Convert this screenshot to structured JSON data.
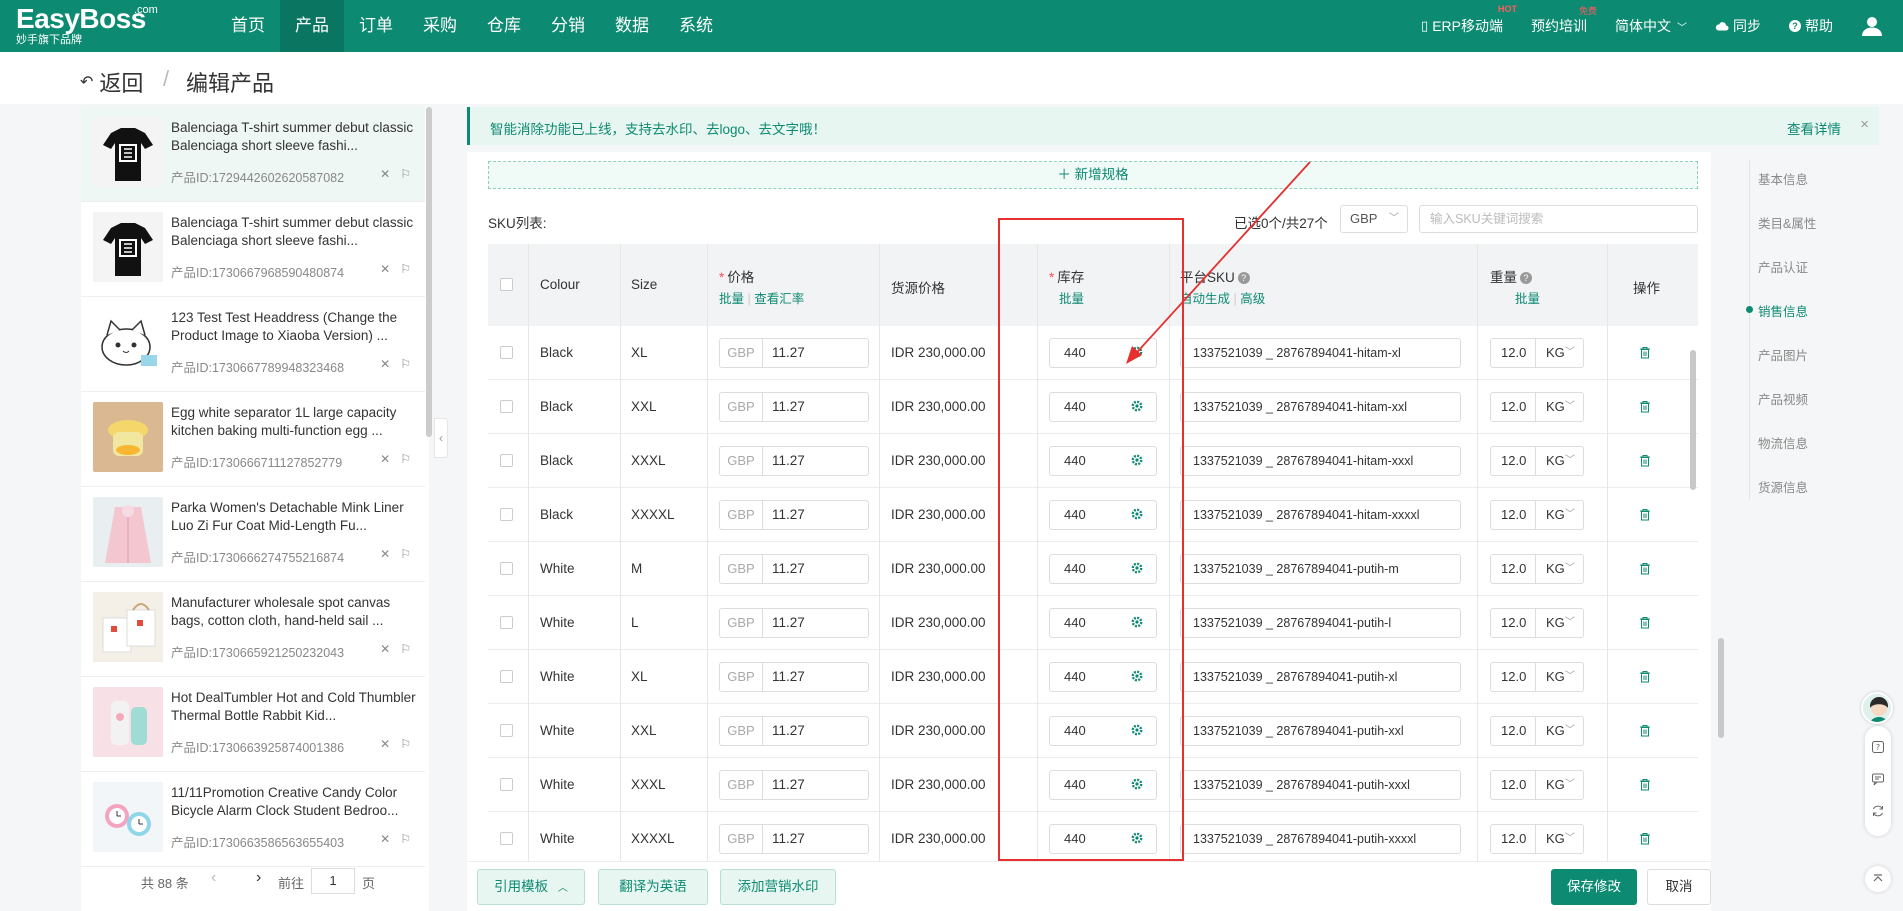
{
  "brand": {
    "name": "EasyBoss",
    "com": ".com",
    "tagline": "妙手旗下品牌"
  },
  "nav": [
    "首页",
    "产品",
    "订单",
    "采购",
    "仓库",
    "分销",
    "数据",
    "系统"
  ],
  "nav_active": "产品",
  "topright": {
    "mobile": "ERP移动端",
    "mobile_badge": "HOT",
    "training": "预约培训",
    "training_badge": "免费",
    "language": "简体中文",
    "sync": "同步",
    "help": "帮助"
  },
  "header": {
    "back": "返回",
    "separator": "/",
    "title": "编辑产品"
  },
  "products": [
    {
      "name": "Balenciaga T-shirt summer debut classic Balenciaga short sleeve fashi...",
      "id": "产品ID:1729442602620587082",
      "img": "tshirt"
    },
    {
      "name": "Balenciaga T-shirt summer debut classic Balenciaga short sleeve fashi...",
      "id": "产品ID:1730667968590480874",
      "img": "tshirt"
    },
    {
      "name": "123 Test Test Headdress (Change the Product Image to Xiaoba Version) ...",
      "id": "产品ID:1730667789948323468",
      "img": "cat"
    },
    {
      "name": "Egg white separator 1L large capacity kitchen baking multi-function egg ...",
      "id": "产品ID:1730666711127852779",
      "img": "egg"
    },
    {
      "name": "Parka Women's Detachable Mink Liner Luo Zi Fur Coat Mid-Length Fu...",
      "id": "产品ID:1730666274755216874",
      "img": "coat"
    },
    {
      "name": "Manufacturer wholesale spot canvas bags, cotton cloth, hand-held sail ...",
      "id": "产品ID:1730665921250232043",
      "img": "bag"
    },
    {
      "name": "Hot DealTumbler Hot and Cold Thumbler Thermal Bottle Rabbit Kid...",
      "id": "产品ID:1730663925874001386",
      "img": "tumbler"
    },
    {
      "name": "11/11Promotion Creative Candy Color Bicycle Alarm Clock Student Bedroo...",
      "id": "产品ID:1730663586563655403",
      "img": "clock"
    }
  ],
  "pager": {
    "total": "共 88 条",
    "prev": "‹",
    "next": "›",
    "goto": "前往",
    "page": "1",
    "page_unit": "页"
  },
  "notice": {
    "text": "智能消除功能已上线，支持去水印、去logo、去文字哦！",
    "link": "查看详情",
    "close": "×"
  },
  "sku": {
    "add_spec": "＋ 新增规格",
    "list_label": "SKU列表:",
    "count": "已选0个/共27个",
    "currency": "GBP",
    "search_placeholder": "输入SKU关键词搜索",
    "headers": {
      "colour": "Colour",
      "size": "Size",
      "price": "价格",
      "price_batch": "批量",
      "price_rate": "查看汇率",
      "source_price": "货源价格",
      "stock": "库存",
      "stock_batch": "批量",
      "platform_sku": "平台SKU",
      "psku_auto": "自动生成",
      "psku_adv": "高级",
      "weight": "重量",
      "weight_batch": "批量",
      "actions": "操作"
    },
    "rows": [
      {
        "colour": "Black",
        "size": "XL",
        "cur": "GBP",
        "price": "11.27",
        "source": "IDR 230,000.00",
        "stock": "440",
        "psku": "1337521039 _ 28767894041-hitam-xl",
        "weight": "12.0",
        "unit": "KG"
      },
      {
        "colour": "Black",
        "size": "XXL",
        "cur": "GBP",
        "price": "11.27",
        "source": "IDR 230,000.00",
        "stock": "440",
        "psku": "1337521039 _ 28767894041-hitam-xxl",
        "weight": "12.0",
        "unit": "KG"
      },
      {
        "colour": "Black",
        "size": "XXXL",
        "cur": "GBP",
        "price": "11.27",
        "source": "IDR 230,000.00",
        "stock": "440",
        "psku": "1337521039 _ 28767894041-hitam-xxxl",
        "weight": "12.0",
        "unit": "KG"
      },
      {
        "colour": "Black",
        "size": "XXXXL",
        "cur": "GBP",
        "price": "11.27",
        "source": "IDR 230,000.00",
        "stock": "440",
        "psku": "1337521039 _ 28767894041-hitam-xxxxl",
        "weight": "12.0",
        "unit": "KG"
      },
      {
        "colour": "White",
        "size": "M",
        "cur": "GBP",
        "price": "11.27",
        "source": "IDR 230,000.00",
        "stock": "440",
        "psku": "1337521039 _ 28767894041-putih-m",
        "weight": "12.0",
        "unit": "KG"
      },
      {
        "colour": "White",
        "size": "L",
        "cur": "GBP",
        "price": "11.27",
        "source": "IDR 230,000.00",
        "stock": "440",
        "psku": "1337521039 _ 28767894041-putih-l",
        "weight": "12.0",
        "unit": "KG"
      },
      {
        "colour": "White",
        "size": "XL",
        "cur": "GBP",
        "price": "11.27",
        "source": "IDR 230,000.00",
        "stock": "440",
        "psku": "1337521039 _ 28767894041-putih-xl",
        "weight": "12.0",
        "unit": "KG"
      },
      {
        "colour": "White",
        "size": "XXL",
        "cur": "GBP",
        "price": "11.27",
        "source": "IDR 230,000.00",
        "stock": "440",
        "psku": "1337521039 _ 28767894041-putih-xxl",
        "weight": "12.0",
        "unit": "KG"
      },
      {
        "colour": "White",
        "size": "XXXL",
        "cur": "GBP",
        "price": "11.27",
        "source": "IDR 230,000.00",
        "stock": "440",
        "psku": "1337521039 _ 28767894041-putih-xxxl",
        "weight": "12.0",
        "unit": "KG"
      },
      {
        "colour": "White",
        "size": "XXXXL",
        "cur": "GBP",
        "price": "11.27",
        "source": "IDR 230,000.00",
        "stock": "440",
        "psku": "1337521039 _ 28767894041-putih-xxxxl",
        "weight": "12.0",
        "unit": "KG"
      }
    ]
  },
  "anchors": [
    "基本信息",
    "类目&属性",
    "产品认证",
    "销售信息",
    "产品图片",
    "产品视频",
    "物流信息",
    "货源信息"
  ],
  "anchor_active": "销售信息",
  "footer": {
    "template": "引用模板",
    "translate": "翻译为英语",
    "watermark": "添加营销水印",
    "save": "保存修改",
    "cancel": "取消"
  },
  "colors": {
    "brand": "#0d8a72",
    "highlight": "#e5302f"
  }
}
